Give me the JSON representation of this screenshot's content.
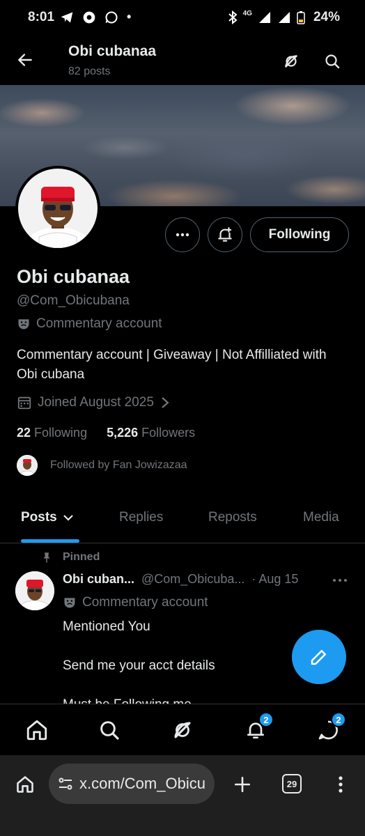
{
  "status_bar": {
    "time": "8:01",
    "network": "4G",
    "battery": "24%",
    "dot": "•"
  },
  "header": {
    "title": "Obi cubanaa",
    "post_count": "82 posts",
    "back_icon": "arrow-left-icon",
    "grok_icon": "grok-icon",
    "search_icon": "search-icon"
  },
  "profile": {
    "name": "Obi cubanaa",
    "handle": "@Com_Obicubana",
    "label": "Commentary account",
    "bio": "Commentary account | Giveaway | Not Affilliated with Obi cubana",
    "joined": "Joined August 2025",
    "following_count": "22",
    "following_label": "Following",
    "followers_count": "5,226",
    "followers_label": "Followers",
    "followed_by": "Followed by Fan Jowizazaa",
    "following_button": "Following"
  },
  "tabs": [
    {
      "label": "Posts",
      "active": true
    },
    {
      "label": "Replies",
      "active": false
    },
    {
      "label": "Reposts",
      "active": false
    },
    {
      "label": "Media",
      "active": false
    }
  ],
  "post": {
    "pinned_label": "Pinned",
    "author_name": "Obi cuban...",
    "author_handle": "@Com_Obicuba...",
    "date": "· Aug 15",
    "label": "Commentary account",
    "line1": "Mentioned You",
    "line2": "Send me your acct details",
    "line3": "Must be Following me"
  },
  "bottom_nav": {
    "notifications_badge": "2",
    "messages_badge": "2"
  },
  "browser": {
    "url": "x.com/Com_Obicu",
    "tab_count": "29"
  },
  "colors": {
    "accent": "#1d9bf0",
    "background": "#000000",
    "muted_text": "#71767b",
    "primary_text": "#e7e9ea",
    "browser_bar": "#1f1f1f"
  }
}
